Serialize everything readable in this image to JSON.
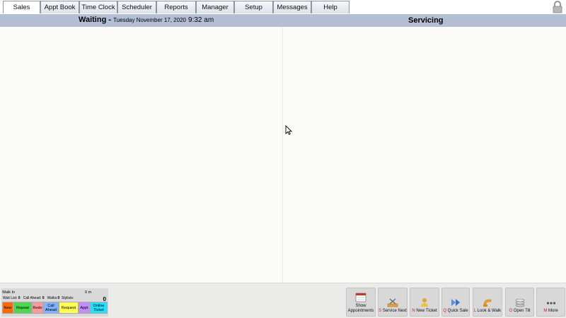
{
  "tabs": [
    {
      "label": "Sales",
      "active": true
    },
    {
      "label": "Appt Book",
      "active": false
    },
    {
      "label": "Time Clock",
      "active": false
    },
    {
      "label": "Scheduler",
      "active": false
    },
    {
      "label": "Reports",
      "active": false
    },
    {
      "label": "Manager",
      "active": false
    },
    {
      "label": "Setup",
      "active": false
    },
    {
      "label": "Messages",
      "active": false
    },
    {
      "label": "Help",
      "active": false
    }
  ],
  "header": {
    "waiting_label": "Waiting -",
    "date": "Tuesday November 17, 2020",
    "time": "9:32 am",
    "servicing_label": "Servicing"
  },
  "walk_in": {
    "title": "Walk In",
    "duration": "0 m",
    "wait_list_label": "Wait List:",
    "wait_list_value": "0",
    "call_ahead_label": "Call Ahead:",
    "call_ahead_value": "0",
    "walks_label": "Walks:",
    "walks_value": "0",
    "stylists_label": "Stylists:",
    "count": "0",
    "buttons": [
      {
        "label": "New",
        "color": "#ff6a00"
      },
      {
        "label": "Repeat",
        "color": "#4cd84c"
      },
      {
        "label": "Redo",
        "color": "#ff9a9a"
      },
      {
        "label": "Call Ahead",
        "color": "#7fb2ff"
      },
      {
        "label": "Request",
        "color": "#ffff55"
      },
      {
        "label": "Appt",
        "color": "#c48aff"
      },
      {
        "label": "Online Ticket",
        "color": "#22e0ff"
      }
    ]
  },
  "actions": [
    {
      "key": "",
      "label": "Show Appointments",
      "icon": "calendar-icon"
    },
    {
      "key": "S",
      "label": "Service Next",
      "icon": "scissors-icon"
    },
    {
      "key": "N",
      "label": "New Ticket",
      "icon": "person-ticket-icon"
    },
    {
      "key": "Q",
      "label": "Quick Sale",
      "icon": "fast-forward-icon"
    },
    {
      "key": "L",
      "label": "Look & Walk",
      "icon": "sign-icon"
    },
    {
      "key": "O",
      "label": "Open Till",
      "icon": "coins-icon"
    },
    {
      "key": "M",
      "label": "More",
      "icon": "more-dots-icon"
    }
  ]
}
